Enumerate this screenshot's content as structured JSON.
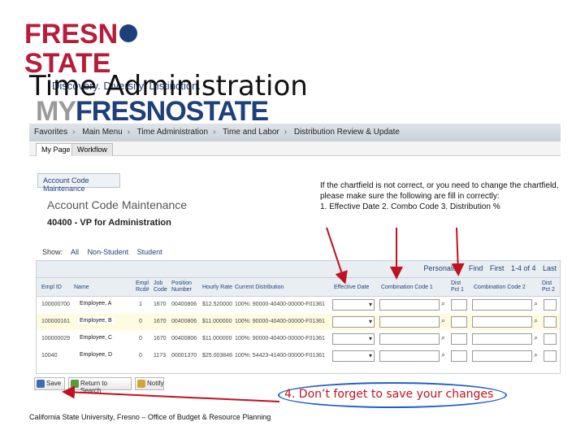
{
  "logo": {
    "brand_left": "FRESN",
    "brand_right": "STATE",
    "tagline": "Discovery. Diversity. Distinction.",
    "icon": "bulldog-paw-icon"
  },
  "slide_title": "Time Administration",
  "app_logo": {
    "my": "MY",
    "name": "FRESNOSTATE"
  },
  "breadcrumb": [
    "Favorites",
    "Main Menu",
    "Time Administration",
    "Time and Labor",
    "Distribution Review & Update"
  ],
  "tabs": [
    {
      "label": "My Page"
    },
    {
      "label": "Workflow"
    }
  ],
  "page_tab": "Account Code Maintenance",
  "page_title": "Account Code Maintenance",
  "department": "40400 - VP for Administration",
  "instructions": {
    "text": "If the chartfield is not correct, or you need to change the chartfield, please make sure the following are fill in correctly:",
    "steps": "1. Effective Date  2. Combo Code  3. Distribution %"
  },
  "show_filter": {
    "label": "Show:",
    "options": [
      "All",
      "Non-Student",
      "Student"
    ]
  },
  "grid_nav": {
    "personalize": "Personalize",
    "find": "Find",
    "first": "First",
    "range": "1-4 of 4",
    "last": "Last"
  },
  "columns": {
    "emplid": "Empl ID",
    "name": "Name",
    "empl_rcd": "Empl Rcd#",
    "job_code": "Job Code",
    "position": "Position Number",
    "hourly_rate": "Hourly Rate",
    "current_dist": "Current Distribution",
    "eff_date": "Effective Date",
    "combo1": "Combination Code 1",
    "dist1": "Dist Pct 1",
    "combo2": "Combination Code 2",
    "dist2": "Dist Pct 2"
  },
  "rows": [
    {
      "emplid": "100000700",
      "name": "Employee, A",
      "rcd": "1",
      "job": "1670",
      "position": "00400806",
      "rate": "$12.520000",
      "dist": "100%: 90000-40400-00000-F01361"
    },
    {
      "emplid": "100000161",
      "name": "Employee, B",
      "rcd": "0",
      "job": "1670",
      "position": "00400806",
      "rate": "$11.000000",
      "dist": "100%: 90000-40400-00000-F01361"
    },
    {
      "emplid": "100000029",
      "name": "Employee, C",
      "rcd": "0",
      "job": "1670",
      "position": "00400806",
      "rate": "$11.000000",
      "dist": "100%: 90000-40400-00000-F01361"
    },
    {
      "emplid": "10040",
      "name": "Employee, D",
      "rcd": "0",
      "job": "1173",
      "position": "00001370",
      "rate": "$25.003846",
      "dist": "100%: 54423-41400-00000-F01361"
    }
  ],
  "buttons": {
    "save": "Save",
    "return": "Return to Search",
    "notify": "Notify"
  },
  "save_note": "4. Don’t forget to save your changes",
  "footer": "California State University, Fresno – Office of Budget & Resource Planning",
  "colors": {
    "fresno_red": "#b71c3a",
    "fresno_blue": "#1d3f7a",
    "arrow_red": "#c1121f",
    "oval_blue": "#1f5fc8"
  }
}
